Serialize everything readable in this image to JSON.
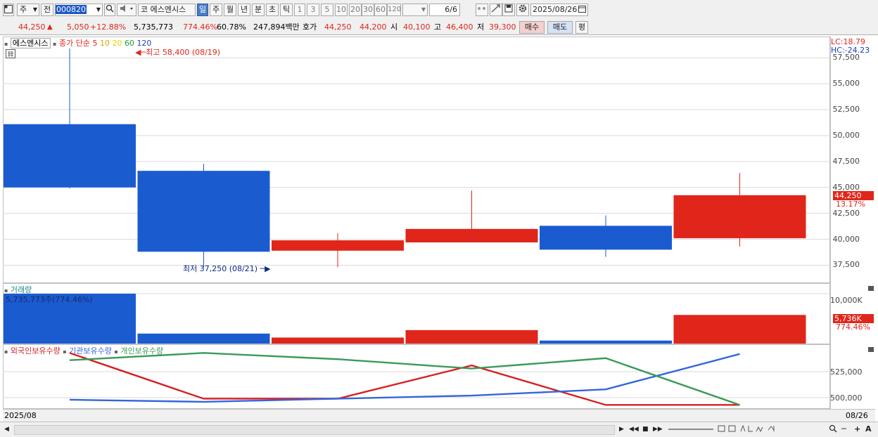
{
  "toolbar": {
    "market": "주",
    "prev_label": "전",
    "code": "000820",
    "name": "코 에스엔시스",
    "periods": [
      "일",
      "주",
      "월",
      "년",
      "분",
      "초",
      "틱"
    ],
    "intervals": [
      "1",
      "3",
      "5",
      "10",
      "20",
      "30",
      "60",
      "120"
    ],
    "page": "6",
    "page_total": "/6",
    "date": "2025/08/26"
  },
  "quote": {
    "price": "44,250",
    "change": "5,050",
    "change_pct": "+12.88%",
    "volume": "5,735,773",
    "volume_ratio": "774.46%",
    "turnover": "60.78%",
    "amount": "247,894백만",
    "bid_label": "호가",
    "ask": "44,250",
    "bid": "44,200",
    "open_label": "시",
    "open": "40,100",
    "high_label": "고",
    "high": "46,400",
    "low_label": "저",
    "low": "39,300",
    "buy_label": "매수",
    "sell_label": "매도",
    "extra_label": "평"
  },
  "price_panel": {
    "stock_label": "에스엔시스",
    "ma_label": "종가 단순",
    "ma_periods": [
      "5",
      "10",
      "20",
      "60",
      "120"
    ],
    "ma_colors": [
      "#e0261a",
      "#d9a600",
      "#e8d200",
      "#1a9a3a",
      "#1a3dbd"
    ],
    "high_marker": "최고 58,400 (08/19)",
    "low_marker": "최저 37,250 (08/21)",
    "lc": "LC:18.79",
    "hc": "HC:-24.23",
    "y_ticks": [
      "57,500",
      "55,000",
      "52,500",
      "50,000",
      "47,500",
      "45,000",
      "42,500",
      "40,000",
      "37,500"
    ],
    "last_price": "44,250",
    "last_change_pct": "13.17%"
  },
  "volume_panel": {
    "title": "거래량",
    "value_label": "5,735,773주(774.46%)",
    "y_tick": "10,000K",
    "last_value": "5,736K",
    "last_pct": "774.46%"
  },
  "holders_panel": {
    "foreign_label": "외국인보유수량",
    "inst_label": "기관보유수량",
    "indiv_label": "개인보유수량",
    "y_ticks": [
      "525,000",
      "500,000"
    ]
  },
  "date_axis": {
    "start": "2025/08",
    "end": "08/26"
  },
  "colors": {
    "up": "#e0261a",
    "down": "#1a5bd0",
    "foreign": "#d62020",
    "institution": "#3366dd",
    "individual": "#3a9a5a"
  },
  "chart_data": [
    {
      "type": "candlestick",
      "title": "",
      "ylim": [
        36000,
        58400
      ],
      "candles": [
        {
          "open": 51100,
          "close": 45000,
          "high": 58400,
          "low": 44900
        },
        {
          "open": 46600,
          "close": 38800,
          "high": 47300,
          "low": 37250
        },
        {
          "open": 38900,
          "close": 39900,
          "high": 40600,
          "low": 37300
        },
        {
          "open": 39700,
          "close": 41000,
          "high": 44700,
          "low": 39700
        },
        {
          "open": 41300,
          "close": 39000,
          "high": 42300,
          "low": 38300
        },
        {
          "open": 40100,
          "close": 44250,
          "high": 46400,
          "low": 39300
        }
      ]
    },
    {
      "type": "bar",
      "title": "거래량",
      "unit": "K",
      "values": [
        10000,
        2000,
        1200,
        2700,
        600,
        5736
      ],
      "directions": [
        "down",
        "down",
        "up",
        "up",
        "down",
        "up"
      ]
    },
    {
      "type": "line",
      "series": [
        {
          "name": "외국인보유수량",
          "values": [
            543000,
            499000,
            499000,
            531000,
            493000,
            493000
          ]
        },
        {
          "name": "기관보유수량",
          "values": [
            498000,
            496000,
            499000,
            502000,
            508000,
            542000
          ]
        },
        {
          "name": "개인보유수량",
          "values": [
            536000,
            543000,
            537000,
            528000,
            538000,
            493000
          ]
        }
      ]
    }
  ]
}
